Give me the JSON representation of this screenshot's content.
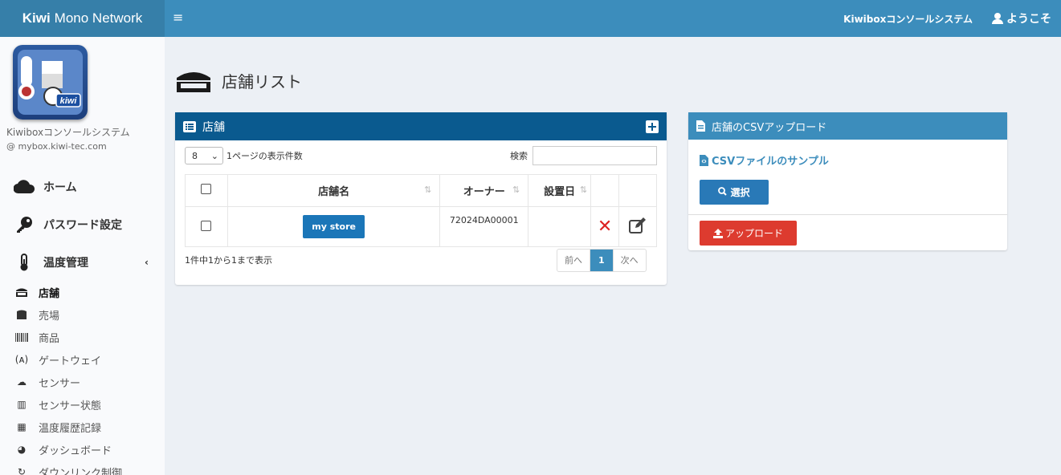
{
  "header": {
    "brand_bold": "Kiwi",
    "brand_rest": "Mono Network",
    "menu_icon": "hamburger-icon",
    "system_name": "Kiwiboxコンソールシステム",
    "user_label": "ようこそ"
  },
  "sidebar": {
    "system_name": "Kiwiboxコンソールシステム",
    "domain": "@ mybox.kiwi-tec.com",
    "nav": [
      {
        "label": "ホーム",
        "icon": "cloud-icon"
      },
      {
        "label": "パスワード設定",
        "icon": "key-icon"
      },
      {
        "label": "温度管理",
        "icon": "thermometer-icon",
        "chevron": "‹"
      }
    ],
    "sub": [
      {
        "label": "店舗",
        "icon": "store-icon",
        "active": true
      },
      {
        "label": "売場",
        "icon": "shop-icon"
      },
      {
        "label": "商品",
        "icon": "barcode-icon"
      },
      {
        "label": "ゲートウェイ",
        "icon": "gateway-icon",
        "glyph": "(ᴀ)"
      },
      {
        "label": "センサー",
        "icon": "sensor-icon",
        "glyph": "☁"
      },
      {
        "label": "センサー状態",
        "icon": "chart-icon",
        "glyph": "▥"
      },
      {
        "label": "温度履歴記録",
        "icon": "calendar-icon",
        "glyph": "▦"
      },
      {
        "label": "ダッシュボード",
        "icon": "dashboard-icon",
        "glyph": "◕"
      },
      {
        "label": "ダウンリンク制御",
        "icon": "refresh-icon",
        "glyph": "↻"
      }
    ]
  },
  "page": {
    "title": "店舗リスト"
  },
  "store_box": {
    "title": "店舗",
    "page_length": "8",
    "page_length_label": "1ページの表示件数",
    "search_label": "検索",
    "search_value": "",
    "columns": [
      "店舗名",
      "オーナー",
      "設置日"
    ],
    "rows": [
      {
        "name": "my store",
        "owner": "72024DA00001",
        "installed": ""
      }
    ],
    "info": "1件中1から1まで表示",
    "prev": "前へ",
    "page": "1",
    "next": "次へ"
  },
  "csv_box": {
    "title": "店舗のCSVアップロード",
    "sample_link": "CSVファイルのサンプル",
    "select_button": "選択",
    "upload_button": "アップロード"
  },
  "colors": {
    "topbar": "#3c8dbc",
    "brand_bg": "#367fa9",
    "box_header": "#0a5a8f",
    "primary_button": "#1b76b8",
    "danger": "#dd3b2f"
  }
}
